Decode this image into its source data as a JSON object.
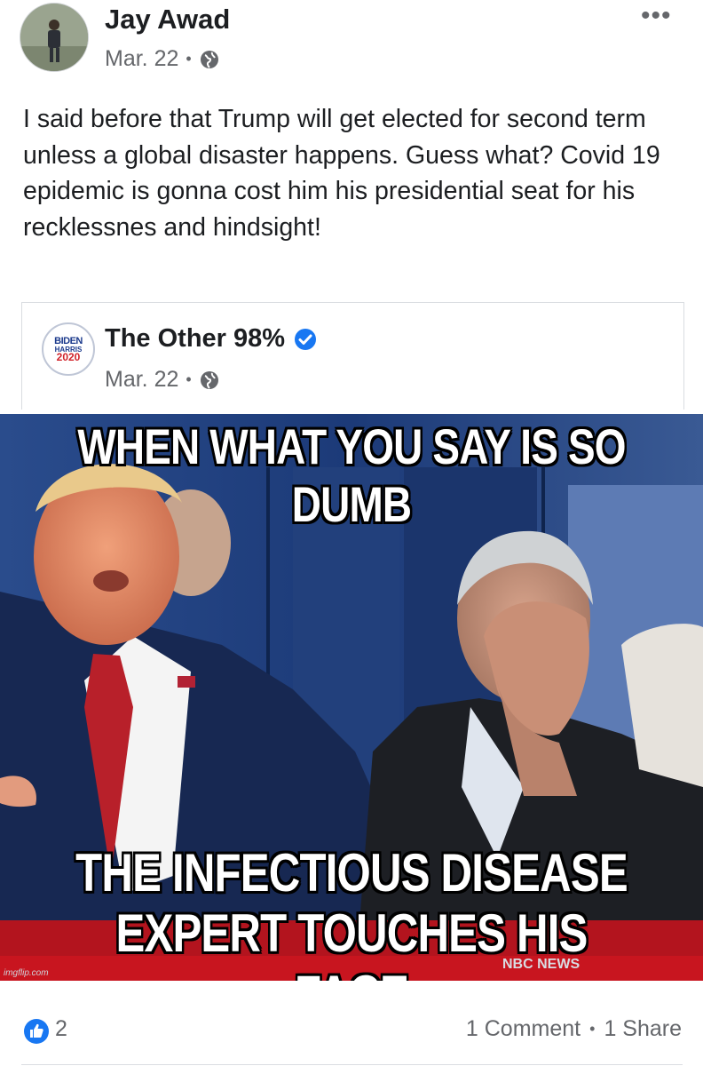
{
  "post": {
    "author": "Jay Awad",
    "date": "Mar. 22",
    "separator": "•",
    "privacy_icon": "globe-icon",
    "more_label": "•••",
    "text": "I said before that Trump will get elected for second term unless a global disaster happens. Guess what? Covid 19 epidemic is gonna cost him his presidential seat for his recklessnes and hindsight!"
  },
  "shared": {
    "page_name": "The Other 98%",
    "verified_icon": "verified-badge-icon",
    "date": "Mar. 22",
    "separator": "•",
    "logo": {
      "line1": "BIDEN",
      "line2": "HARRIS",
      "line3": "2020"
    }
  },
  "meme": {
    "top_caption": "WHEN WHAT YOU SAY IS SO DUMB",
    "bottom_caption_1": "THE INFECTIOUS DISEASE",
    "bottom_caption_2": "EXPERT TOUCHES HIS FACE",
    "watermark": "imgflip.com",
    "broadcast_tag": "NBC NEWS"
  },
  "footer": {
    "like_count": "2",
    "comments": "1 Comment",
    "separator": "•",
    "shares": "1 Share"
  },
  "colors": {
    "text": "#1c1e21",
    "secondary": "#65676b",
    "like_blue": "#1877f2",
    "border": "#dadde1"
  }
}
